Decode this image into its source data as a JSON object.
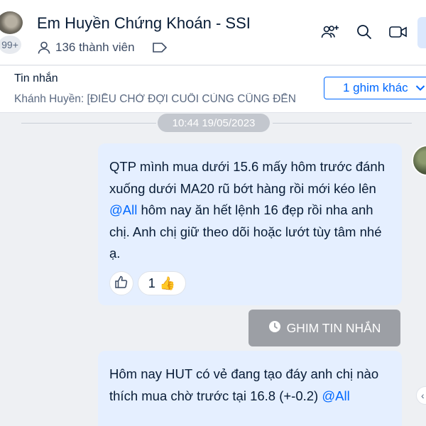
{
  "header": {
    "avatar_count": "99+",
    "title": "Em Huyền Chứng Khoán - SSI",
    "members": "136 thành viên"
  },
  "pinned": {
    "title": "Tin nhắn",
    "preview": "Khánh Huyền: [ĐIỀU CHỜ ĐỢI CUỐI CÙNG CŨNG ĐẾN",
    "more_label": "1 ghim khác",
    "more_icon": "chevron-down"
  },
  "chat": {
    "timestamp": "10:44 19/05/2023",
    "message1": {
      "part1": "QTP mình mua dưới 15.6 mấy hôm trước đánh xuống dưới MA20 rũ bớt hàng rồi mới kéo lên ",
      "mention": "@All",
      "part2": " hôm nay ăn hết lệnh 16 đẹp rồi nha anh chị. Anh chị giữ theo dõi hoặc lướt tùy tâm nhé ạ.",
      "reaction_count": "1",
      "reaction_emoji": "👍"
    },
    "pin_button_label": "GHIM TIN NHẮN",
    "message2": {
      "part1": "Hôm nay HUT có vẻ đang tạo đáy anh chị nào thích mua chờ trước tại 16.8 (+-0.2) ",
      "mention": "@All"
    }
  },
  "colors": {
    "accent": "#0068ff",
    "bubble": "#e5efff",
    "background": "#eef0f3",
    "pin_button": "#9c9fa5"
  }
}
